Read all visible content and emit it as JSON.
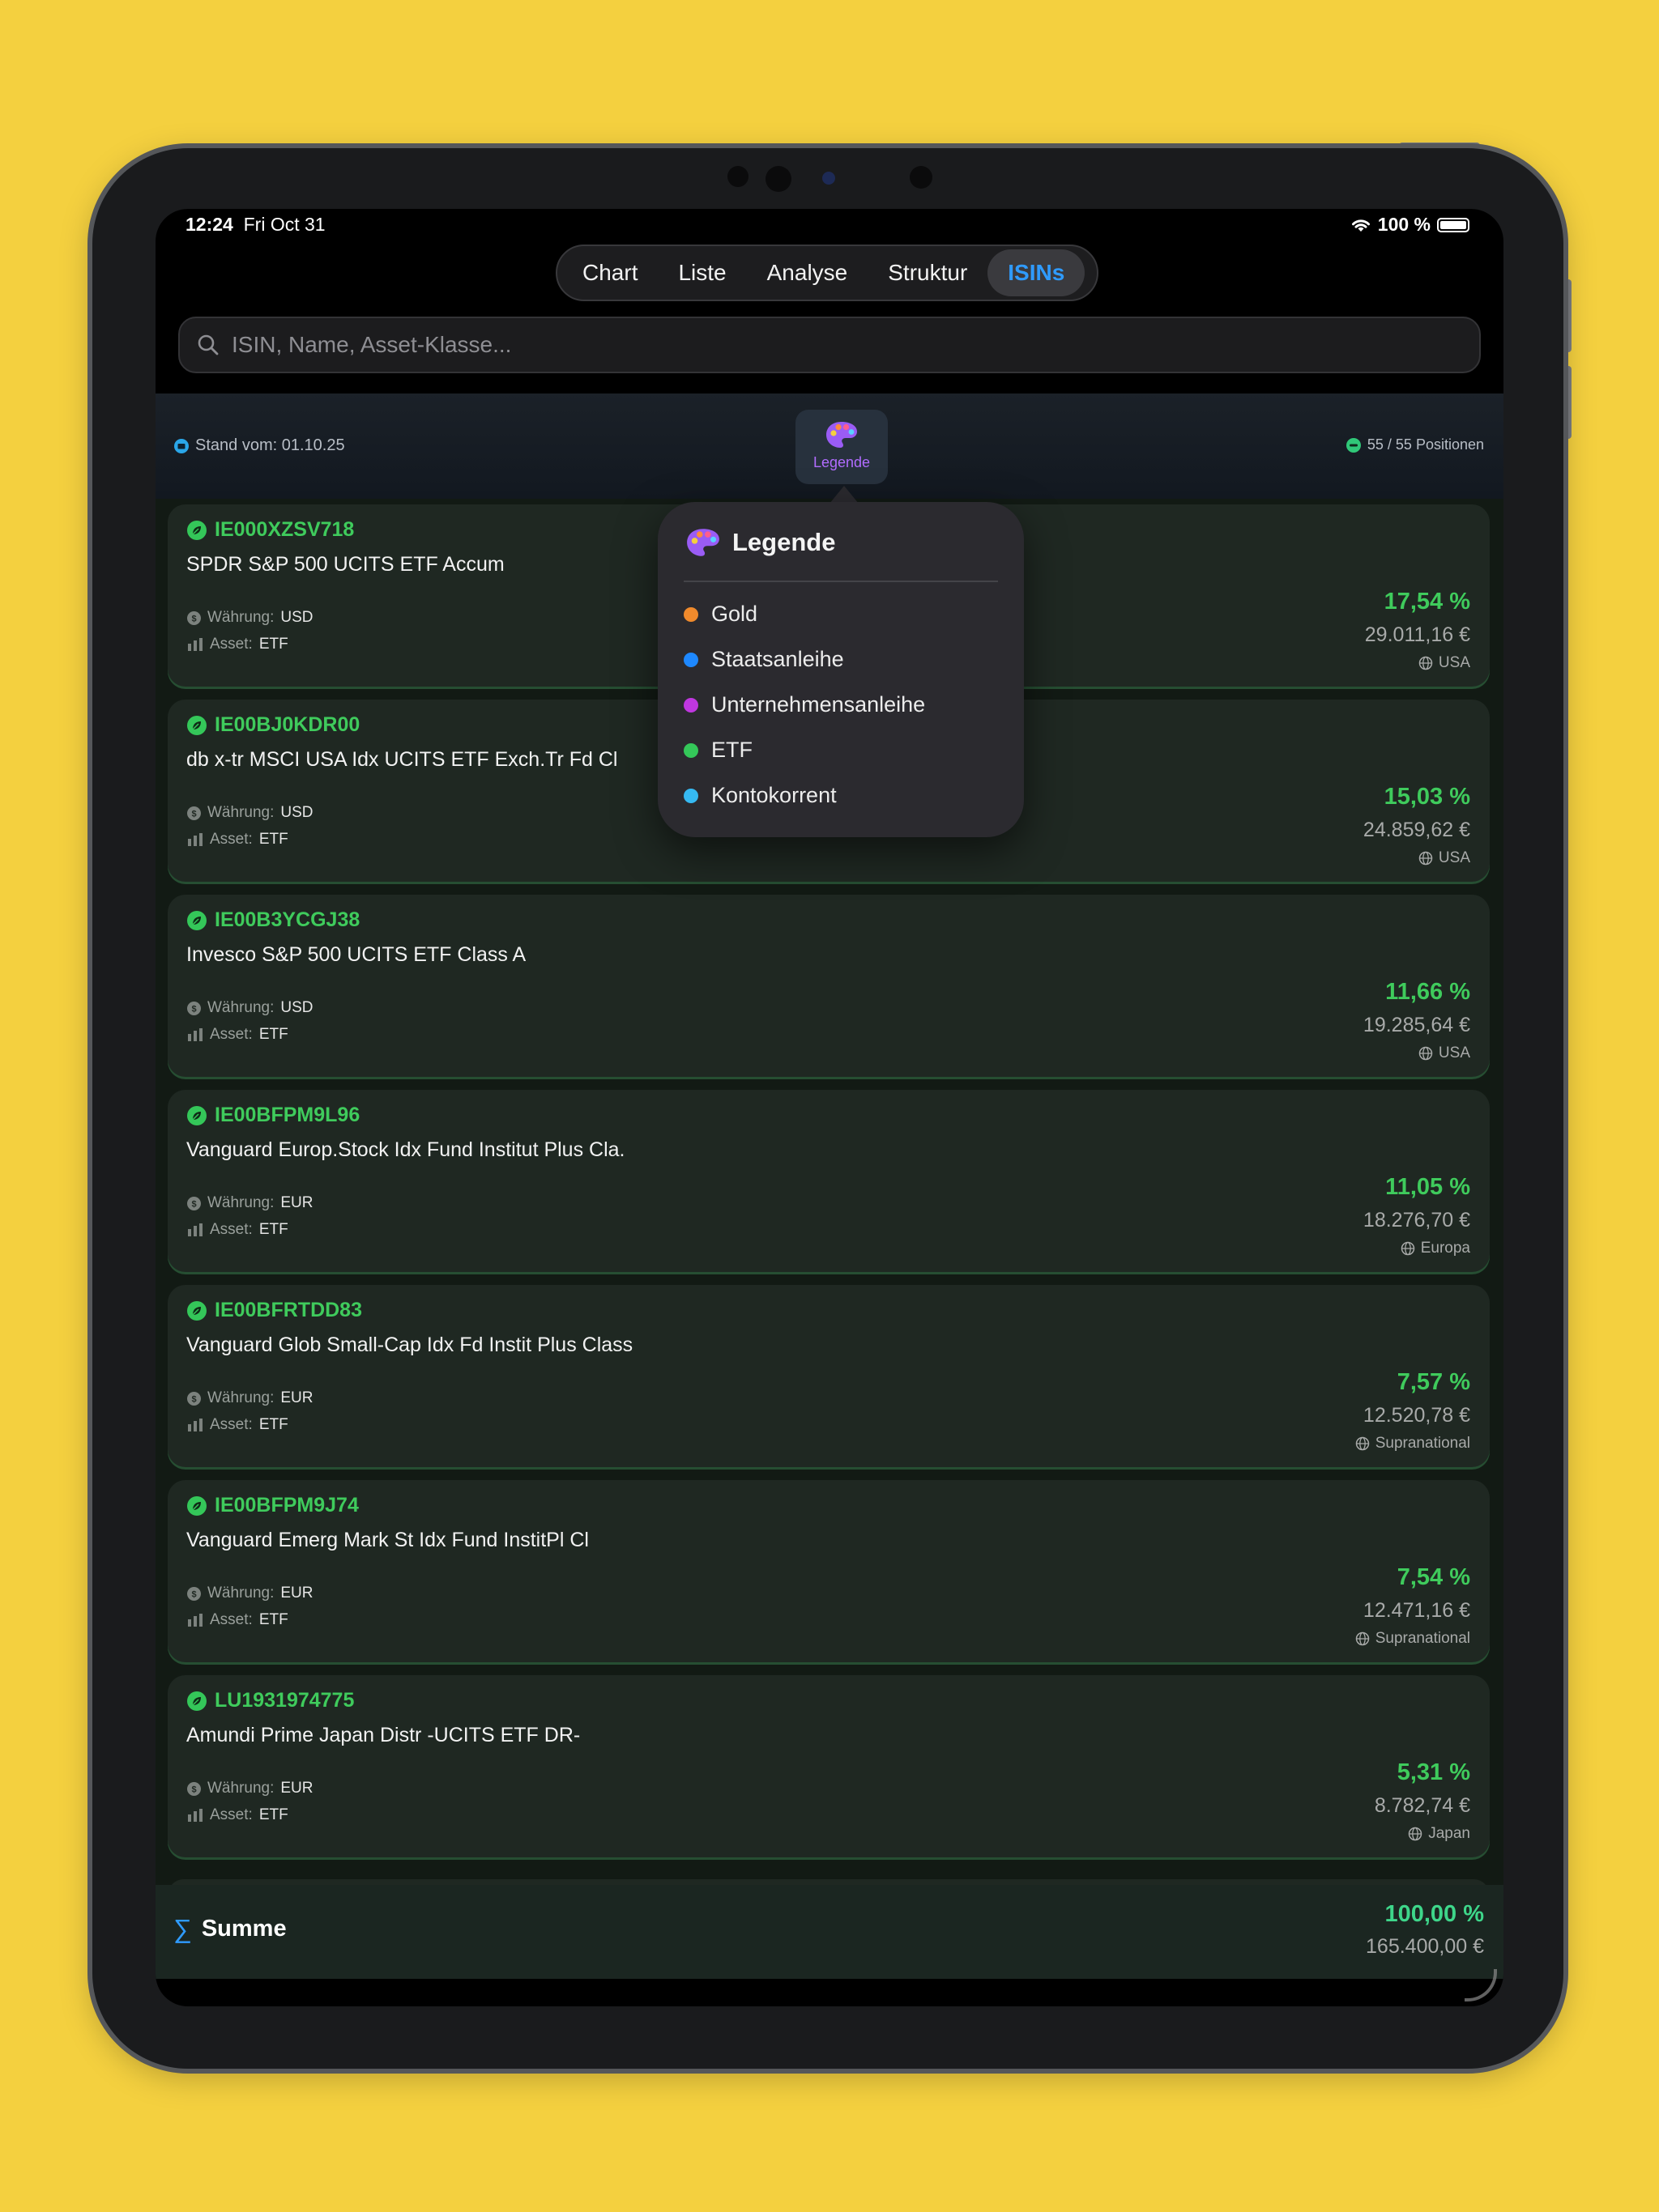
{
  "status": {
    "time": "12:24",
    "date": "Fri Oct 31",
    "battery": "100 %"
  },
  "tabs": [
    {
      "label": "Chart",
      "active": false
    },
    {
      "label": "Liste",
      "active": false
    },
    {
      "label": "Analyse",
      "active": false
    },
    {
      "label": "Struktur",
      "active": false
    },
    {
      "label": "ISINs",
      "active": true
    }
  ],
  "search": {
    "placeholder": "ISIN, Name, Asset-Klasse...",
    "value": ""
  },
  "info": {
    "stand": "Stand vom: 01.10.25",
    "legend_button": "Legende",
    "positions": "55 / 55 Positionen"
  },
  "legend": {
    "title": "Legende",
    "items": [
      {
        "label": "Gold",
        "color": "#f08a2c"
      },
      {
        "label": "Staatsanleihe",
        "color": "#1e88ff"
      },
      {
        "label": "Unternehmensanleihe",
        "color": "#c037e0"
      },
      {
        "label": "ETF",
        "color": "#34c759"
      },
      {
        "label": "Kontokorrent",
        "color": "#36b9f2"
      }
    ]
  },
  "labels": {
    "currency": "Währung:",
    "asset": "Asset:"
  },
  "positions": [
    {
      "isin": "IE000XZSV718",
      "name": "SPDR S&P 500 UCITS ETF Accum",
      "currency": "USD",
      "asset": "ETF",
      "percent": "17,54 %",
      "value": "29.011,16 €",
      "region": "USA"
    },
    {
      "isin": "IE00BJ0KDR00",
      "name": "db x-tr MSCI USA Idx UCITS ETF Exch.Tr Fd Cl",
      "currency": "USD",
      "asset": "ETF",
      "percent": "15,03 %",
      "value": "24.859,62 €",
      "region": "USA"
    },
    {
      "isin": "IE00B3YCGJ38",
      "name": "Invesco S&P 500 UCITS ETF Class A",
      "currency": "USD",
      "asset": "ETF",
      "percent": "11,66 %",
      "value": "19.285,64 €",
      "region": "USA"
    },
    {
      "isin": "IE00BFPM9L96",
      "name": "Vanguard Europ.Stock Idx Fund Institut Plus Cla.",
      "currency": "EUR",
      "asset": "ETF",
      "percent": "11,05 %",
      "value": "18.276,70 €",
      "region": "Europa"
    },
    {
      "isin": "IE00BFRTDD83",
      "name": "Vanguard Glob Small-Cap Idx Fd Instit Plus Class",
      "currency": "EUR",
      "asset": "ETF",
      "percent": "7,57 %",
      "value": "12.520,78 €",
      "region": "Supranational"
    },
    {
      "isin": "IE00BFPM9J74",
      "name": "Vanguard Emerg Mark St Idx Fund InstitPl Cl",
      "currency": "EUR",
      "asset": "ETF",
      "percent": "7,54 %",
      "value": "12.471,16 €",
      "region": "Supranational"
    },
    {
      "isin": "LU1931974775",
      "name": "Amundi Prime Japan Distr -UCITS ETF DR-",
      "currency": "EUR",
      "asset": "ETF",
      "percent": "5,31 %",
      "value": "8.782,74 €",
      "region": "Japan"
    }
  ],
  "summary": {
    "label": "Summe",
    "percent": "100,00 %",
    "value": "165.400,00 €"
  }
}
